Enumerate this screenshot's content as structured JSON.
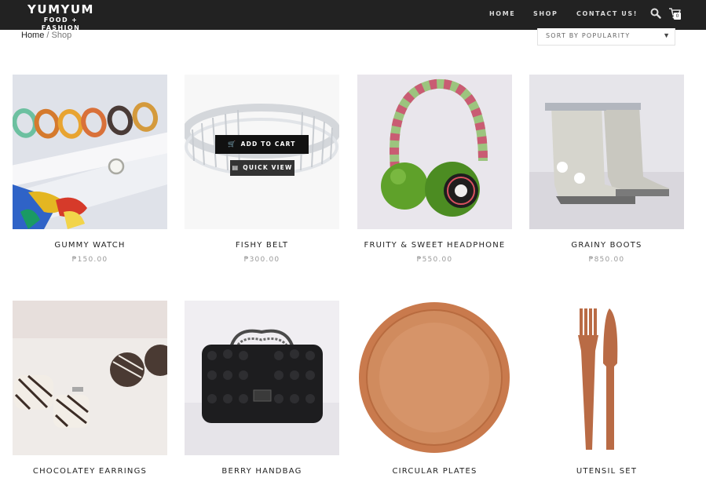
{
  "header": {
    "logo_title": "YUMYUM",
    "logo_tagline": "FOOD + FASHION",
    "nav": [
      "HOME",
      "SHOP",
      "CONTACT US!"
    ],
    "cart_count": "0",
    "background": "#222222"
  },
  "breadcrumb": {
    "home": "Home",
    "separator": " / ",
    "current": "Shop"
  },
  "sort": {
    "selected": "SORT BY POPULARITY"
  },
  "hover_actions": {
    "add_to_cart": "ADD TO CART",
    "quick_view": "QUICK VIEW"
  },
  "products": [
    {
      "name": "GUMMY WATCH",
      "price": "₱150.00"
    },
    {
      "name": "FISHY BELT",
      "price": "₱300.00"
    },
    {
      "name": "FRUITY & SWEET HEADPHONE",
      "price": "₱550.00"
    },
    {
      "name": "GRAINY BOOTS",
      "price": "₱850.00"
    },
    {
      "name": "CHOCOLATEY EARRINGS"
    },
    {
      "name": "BERRY HANDBAG"
    },
    {
      "name": "CIRCULAR PLATES"
    },
    {
      "name": "UTENSIL SET"
    }
  ]
}
